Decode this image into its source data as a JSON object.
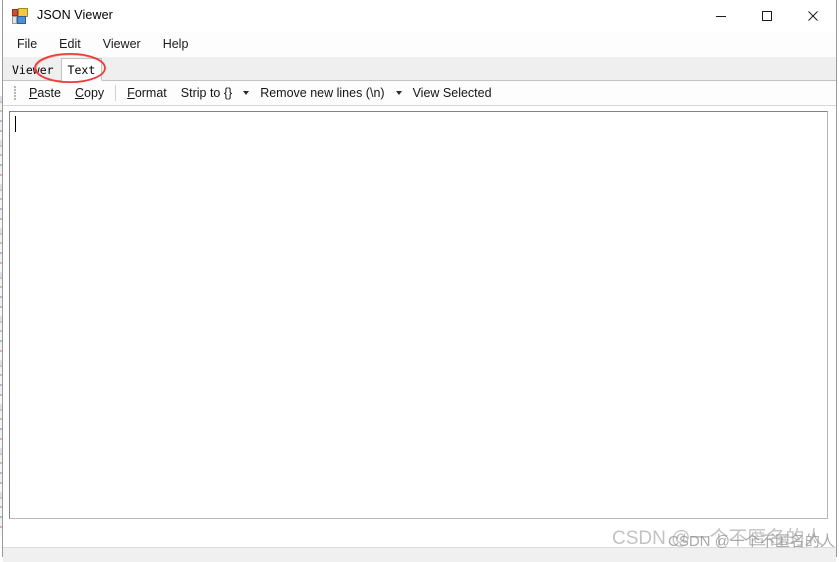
{
  "window": {
    "title": "JSON Viewer",
    "icon": "app-window-icon",
    "controls": {
      "minimize": "minimize-icon",
      "maximize": "maximize-icon",
      "close": "close-icon"
    }
  },
  "menu": {
    "items": [
      {
        "label": "File"
      },
      {
        "label": "Edit"
      },
      {
        "label": "Viewer"
      },
      {
        "label": "Help"
      }
    ]
  },
  "tabs": {
    "items": [
      {
        "label": "Viewer",
        "active": false
      },
      {
        "label": "Text",
        "active": true
      }
    ],
    "selected": "Text"
  },
  "toolbar": {
    "grip": "drag-grip-icon",
    "paste": {
      "mnemonic": "P",
      "rest": "aste"
    },
    "copy": {
      "mnemonic": "C",
      "rest": "opy"
    },
    "format": {
      "mnemonic": "F",
      "rest": "ormat"
    },
    "strip_to": "Strip to {}",
    "remove_new_lines": "Remove new lines (\\n)",
    "view_selected": "View Selected",
    "dropdown_icon": "chevron-down-icon"
  },
  "editor": {
    "value": "",
    "placeholder": "",
    "caret_visible": true
  },
  "status_bar": {
    "text": ""
  },
  "annotation": {
    "shape": "ellipse",
    "color": "#ee3b3b",
    "target": "Text"
  },
  "watermarks": {
    "back": "CSDN @一个不匿名的人",
    "front": "CSDN @一个不匿名的人"
  },
  "colors": {
    "accent_red": "#ee3b3b",
    "window_border": "#9a9a9a",
    "tabstrip_bg": "#efefef",
    "statusbar_bg": "#f0f0f0",
    "editor_border": "#828282"
  }
}
